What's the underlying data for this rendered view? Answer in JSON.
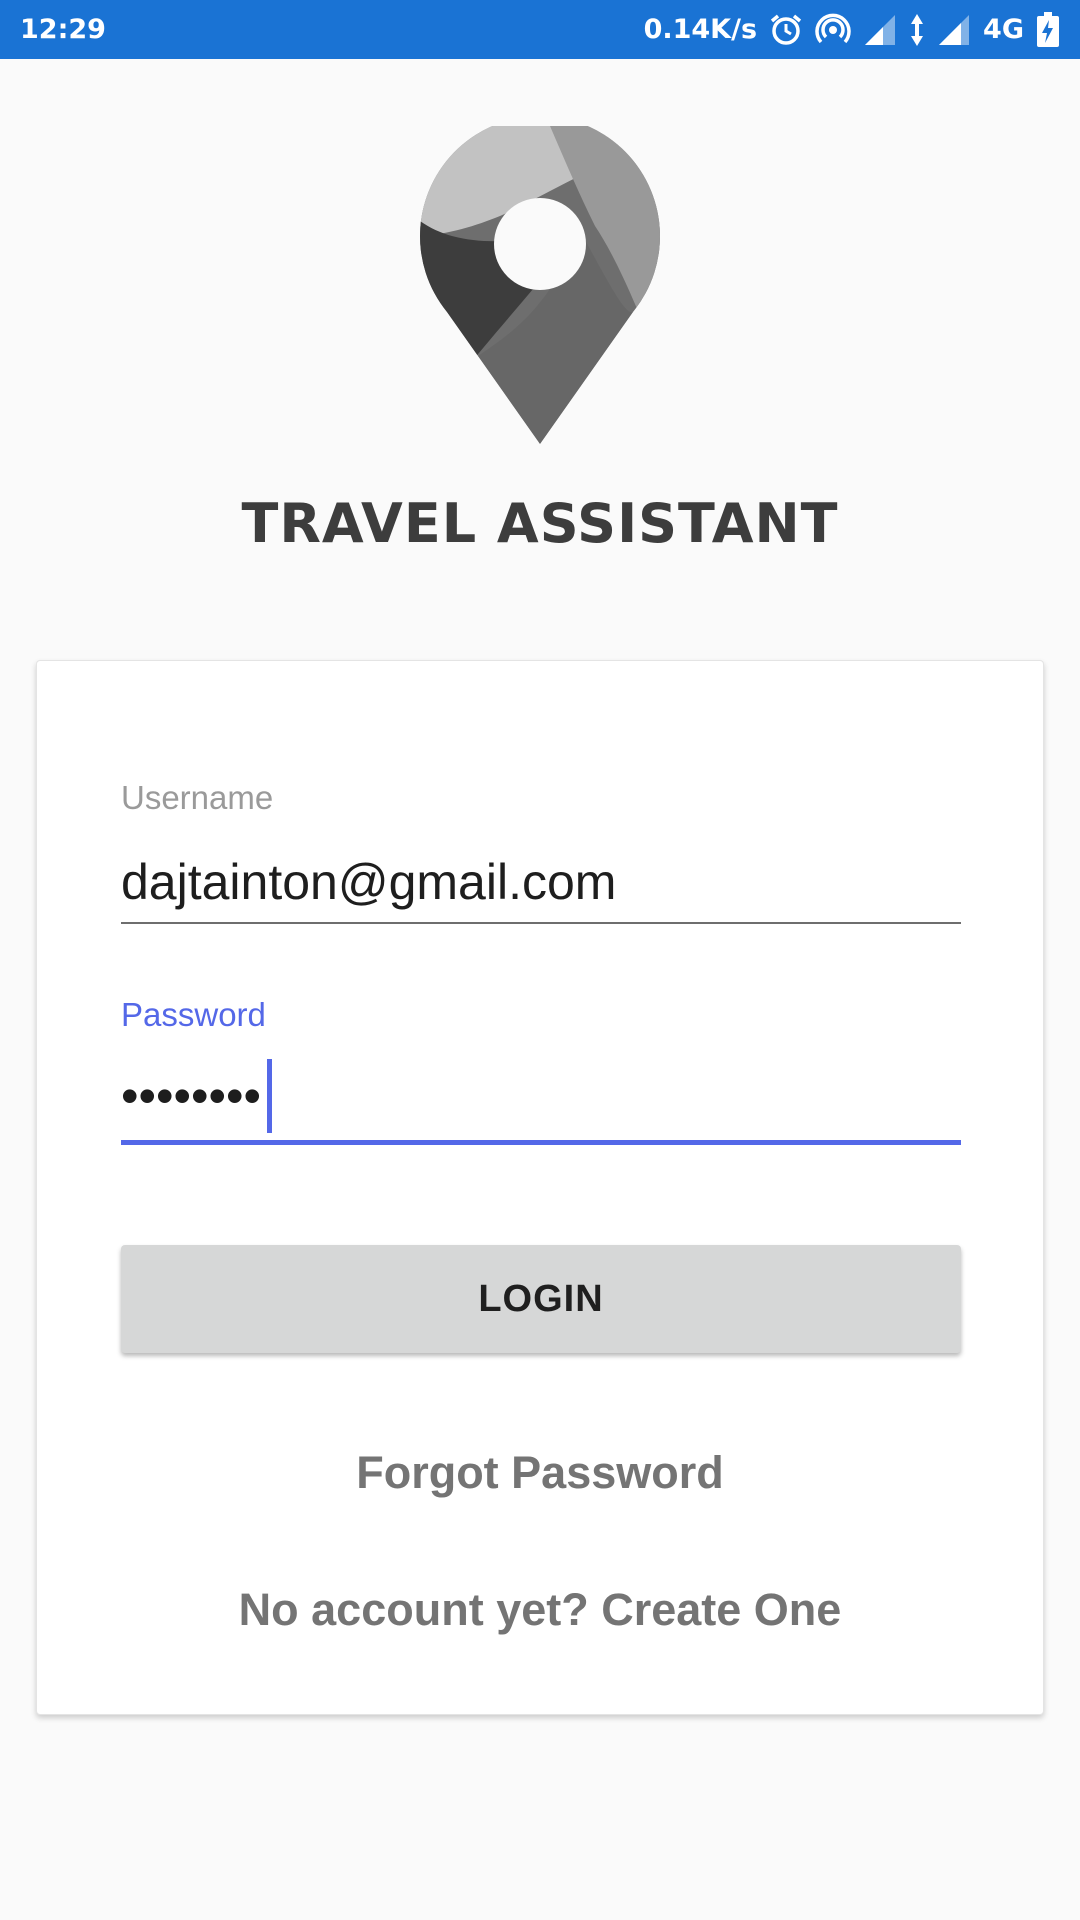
{
  "status_bar": {
    "time": "12:29",
    "network_speed": "0.14K/s",
    "network_type": "4G",
    "icons": [
      "alarm-icon",
      "hotspot-icon",
      "signal-icon",
      "data-arrows-icon",
      "signal-icon",
      "battery-charging-icon"
    ]
  },
  "app": {
    "title": "TRAVEL ASSISTANT",
    "logo_icon": "map-pin-logo-icon"
  },
  "form": {
    "username": {
      "label": "Username",
      "value": "dajtainton@gmail.com"
    },
    "password": {
      "label": "Password",
      "value": "••••••••"
    },
    "login_label": "LOGIN",
    "forgot_label": "Forgot Password",
    "create_label": "No account yet? Create One"
  },
  "colors": {
    "status_bar": "#1a73d4",
    "accent": "#5468e8",
    "background": "#fafafa",
    "button": "#d6d7d7",
    "link_text": "#747474"
  }
}
